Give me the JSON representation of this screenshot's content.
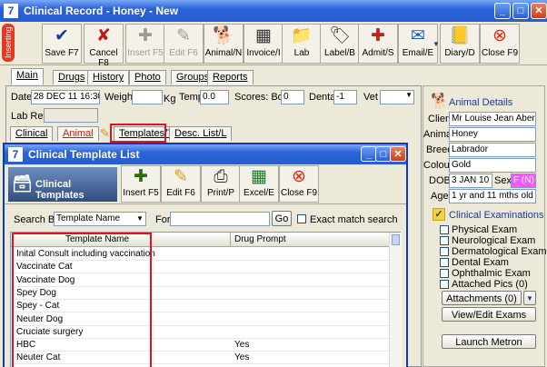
{
  "window": {
    "title": "Clinical Record - Honey - New"
  },
  "toolbar": {
    "status_label": "Inserting",
    "buttons": [
      {
        "label": "Save F7",
        "glyph": "✔",
        "color": "#1a3a9a",
        "disabled": false
      },
      {
        "label": "Cancel F8",
        "glyph": "✘",
        "color": "#c01818",
        "disabled": false
      },
      {
        "label": "Insert F5",
        "glyph": "✚",
        "color": "#9a9a9a",
        "disabled": true
      },
      {
        "label": "Edit F6",
        "glyph": "✎",
        "color": "#9a9a9a",
        "disabled": true
      },
      {
        "label": "Animal/N",
        "glyph": "🐕",
        "color": "#333333",
        "disabled": false
      },
      {
        "label": "Invoice/I",
        "glyph": "▦",
        "color": "#333333",
        "disabled": false
      },
      {
        "label": "Lab",
        "glyph": "📁",
        "color": "#d8a020",
        "disabled": false
      },
      {
        "label": "Label/B",
        "glyph": "🏷",
        "color": "#333333",
        "disabled": false
      },
      {
        "label": "Admit/S",
        "glyph": "✚",
        "color": "#c02020",
        "disabled": false
      },
      {
        "label": "Email/E",
        "glyph": "✉",
        "color": "#1a5ab8",
        "disabled": false
      },
      {
        "label": "Diary/D",
        "glyph": "📒",
        "color": "#8a5a10",
        "disabled": false
      },
      {
        "label": "Close F9",
        "glyph": "⊗",
        "color": "#e02a10",
        "disabled": false
      }
    ]
  },
  "main_tabs": [
    "Main",
    "Drugs",
    "History",
    "Photo",
    "Groups",
    "Reports"
  ],
  "form": {
    "date_label": "Date",
    "date_value": "28 DEC 11  16:30",
    "weight_label": "Weight",
    "weight_unit": "Kg",
    "temp_label": "Temp",
    "temp_value": "0.0",
    "scores_label": "Scores: Body",
    "body_value": "0",
    "dental_label": "Dental",
    "dental_value": "-1",
    "vet_label": "Vet",
    "labref_label": "Lab Ref"
  },
  "sub_tabs": {
    "clinical": "Clinical",
    "animal": "Animal",
    "templates": "Templates/T",
    "desc": "Desc. List/L"
  },
  "animal_details": {
    "heading": "Animal Details",
    "client_label": "Client",
    "client_value": "Mr Louise Jean Abernethy",
    "animal_label": "Animal",
    "animal_value": "Honey",
    "breed_label": "Breed",
    "breed_value": "Labrador",
    "colour_label": "Colour",
    "colour_value": "Gold",
    "dob_label": "DOB",
    "dob_value": "3 JAN 10",
    "sex_label": "Sex",
    "sex_value": "F (N)",
    "age_label": "Age",
    "age_value": "1 yr and 11 mths old"
  },
  "exams": {
    "heading": "Clinical Examinations",
    "items": [
      "Physical Exam",
      "Neurological Exam",
      "Dermatological Exam",
      "Dental Exam",
      "Ophthalmic Exam",
      "Attached Pics (0)"
    ],
    "attachments_label": "Attachments (0)",
    "view_edit_label": "View/Edit Exams",
    "launch_label": "Launch Metron"
  },
  "dialog": {
    "title": "Clinical Template List",
    "banner": "Clinical Templates",
    "buttons": [
      {
        "label": "Insert F5",
        "glyph": "✚",
        "color": "#2a6a10"
      },
      {
        "label": "Edit F6",
        "glyph": "✎",
        "color": "#d8a020"
      },
      {
        "label": "Print/P",
        "glyph": "⎙",
        "color": "#333333"
      },
      {
        "label": "Excel/E",
        "glyph": "▦",
        "color": "#1a7a2a"
      },
      {
        "label": "Close F9",
        "glyph": "⊗",
        "color": "#e02a10"
      }
    ],
    "search_by_label": "Search By",
    "search_by_value": "Template Name",
    "for_label": "For",
    "go_label": "Go",
    "exact_label": "Exact match search",
    "columns": [
      "Template Name",
      "Drug Prompt"
    ],
    "rows": [
      {
        "name": "Inital Consult including vaccination",
        "drug": ""
      },
      {
        "name": "Vaccinate Cat",
        "drug": ""
      },
      {
        "name": "Vaccinate Dog",
        "drug": ""
      },
      {
        "name": "Spey Dog",
        "drug": ""
      },
      {
        "name": "Spey - Cat",
        "drug": ""
      },
      {
        "name": "Neuter Dog",
        "drug": ""
      },
      {
        "name": "Cruciate surgery",
        "drug": ""
      },
      {
        "name": "HBC",
        "drug": "Yes"
      },
      {
        "name": "Neuter Cat",
        "drug": "Yes"
      }
    ]
  }
}
